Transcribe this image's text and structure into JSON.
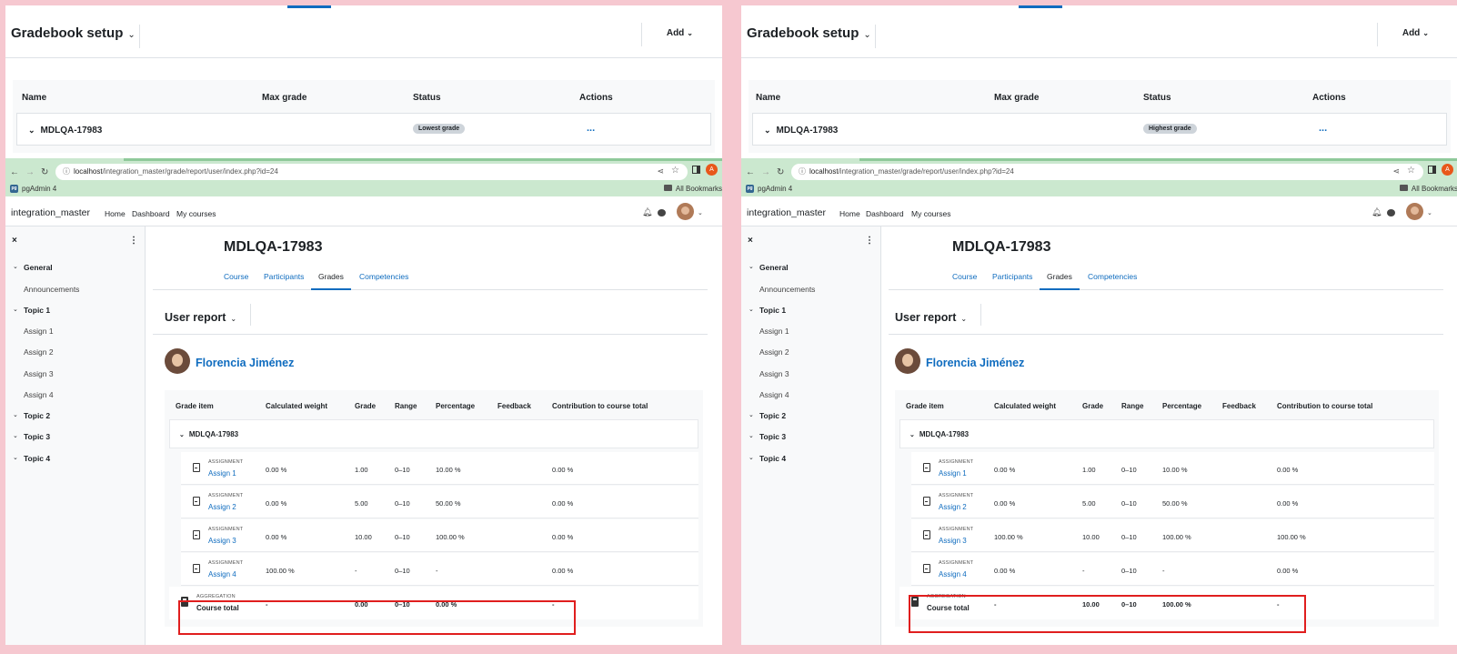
{
  "gradebook": {
    "title": "Gradebook setup",
    "add_label": "Add",
    "headers": {
      "name": "Name",
      "max_grade": "Max grade",
      "status": "Status",
      "actions": "Actions"
    },
    "row_name": "MDLQA-17983",
    "actions_dots": "...",
    "status_left": "Lowest grade",
    "status_right": "Highest grade"
  },
  "browser": {
    "url_host": "localhost",
    "url_path": "/integration_master/grade/report/user/index.php?id=24",
    "bookmark": "pgAdmin 4",
    "all_bookmarks": "All Bookmarks",
    "profile_initial": "A"
  },
  "site": {
    "name": "integration_master",
    "nav": [
      "Home",
      "Dashboard",
      "My courses"
    ]
  },
  "drawer": {
    "close": "×",
    "kebab": "⋮",
    "sections": [
      {
        "label": "General",
        "items": [
          "Announcements"
        ]
      },
      {
        "label": "Topic 1",
        "items": [
          "Assign 1",
          "Assign 2",
          "Assign 3",
          "Assign 4"
        ]
      },
      {
        "label": "Topic 2",
        "items": []
      },
      {
        "label": "Topic 3",
        "items": []
      },
      {
        "label": "Topic 4",
        "items": []
      }
    ]
  },
  "course": {
    "title": "MDLQA-17983",
    "tabs": [
      "Course",
      "Participants",
      "Grades",
      "Competencies"
    ],
    "active_tab": "Grades"
  },
  "report": {
    "title": "User report",
    "user_name": "Florencia Jiménez",
    "columns": [
      "Grade item",
      "Calculated weight",
      "Grade",
      "Range",
      "Percentage",
      "Feedback",
      "Contribution to course total"
    ],
    "category": "MDLQA-17983",
    "item_type": "ASSIGNMENT",
    "total_type": "AGGREGATION",
    "total_name": "Course total"
  },
  "left_rows": [
    {
      "name": "Assign 1",
      "weight": "0.00 %",
      "grade": "1.00",
      "range": "0–10",
      "pct": "10.00 %",
      "contrib": "0.00 %"
    },
    {
      "name": "Assign 2",
      "weight": "0.00 %",
      "grade": "5.00",
      "range": "0–10",
      "pct": "50.00 %",
      "contrib": "0.00 %"
    },
    {
      "name": "Assign 3",
      "weight": "0.00 %",
      "grade": "10.00",
      "range": "0–10",
      "pct": "100.00 %",
      "contrib": "0.00 %"
    },
    {
      "name": "Assign 4",
      "weight": "100.00 %",
      "grade": "-",
      "range": "0–10",
      "pct": "-",
      "contrib": "0.00 %"
    }
  ],
  "left_total": {
    "weight": "-",
    "grade": "0.00",
    "range": "0–10",
    "pct": "0.00 %",
    "contrib": "-"
  },
  "right_rows": [
    {
      "name": "Assign 1",
      "weight": "0.00 %",
      "grade": "1.00",
      "range": "0–10",
      "pct": "10.00 %",
      "contrib": "0.00 %"
    },
    {
      "name": "Assign 2",
      "weight": "0.00 %",
      "grade": "5.00",
      "range": "0–10",
      "pct": "50.00 %",
      "contrib": "0.00 %"
    },
    {
      "name": "Assign 3",
      "weight": "100.00 %",
      "grade": "10.00",
      "range": "0–10",
      "pct": "100.00 %",
      "contrib": "100.00 %"
    },
    {
      "name": "Assign 4",
      "weight": "0.00 %",
      "grade": "-",
      "range": "0–10",
      "pct": "-",
      "contrib": "0.00 %"
    }
  ],
  "right_total": {
    "weight": "-",
    "grade": "10.00",
    "range": "0–10",
    "pct": "100.00 %",
    "contrib": "-"
  },
  "colors": {
    "accent": "#0f6cbf",
    "highlight": "#e01e1e",
    "page_bg": "#f6c8d0",
    "chrome": "#cbe8cf"
  }
}
